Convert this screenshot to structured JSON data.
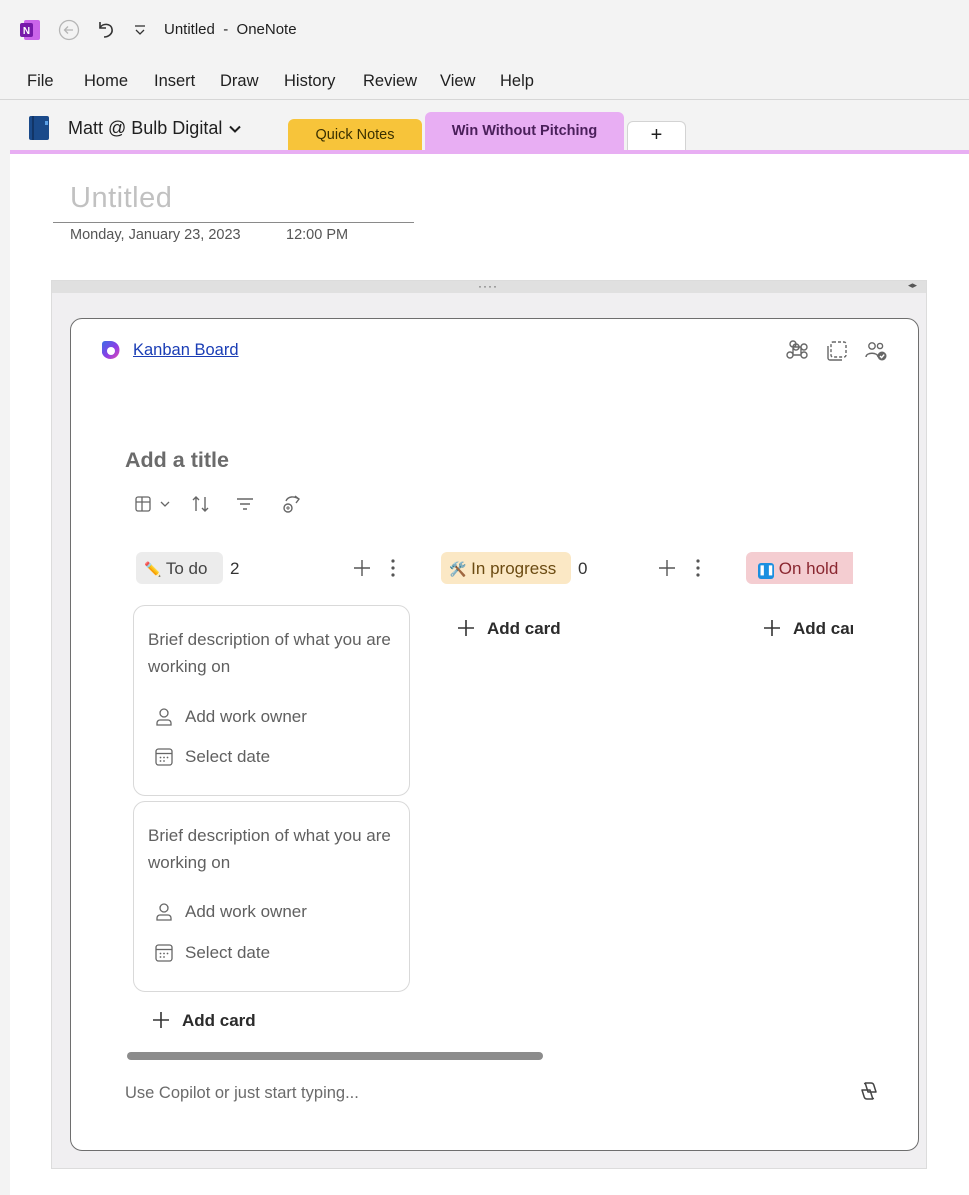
{
  "window": {
    "title": "Untitled  -  OneNote"
  },
  "menu": [
    "File",
    "Home",
    "Insert",
    "Draw",
    "History",
    "Review",
    "View",
    "Help"
  ],
  "notebook": {
    "name": "Matt @ Bulb Digital"
  },
  "sections": [
    {
      "label": "Quick Notes",
      "color": "#f7c43a"
    },
    {
      "label": "Win Without Pitching",
      "color": "#e8aef3",
      "active": true
    },
    {
      "label": "+"
    }
  ],
  "page": {
    "title": "Untitled",
    "date": "Monday, January 23, 2023",
    "time": "12:00 PM"
  },
  "loop": {
    "link": "Kanban Board",
    "board_title": "Add a title",
    "columns": [
      {
        "emoji": "✏️",
        "label": "To do",
        "count": "2",
        "color": "#ececec"
      },
      {
        "emoji": "🛠️",
        "label": "In progress",
        "count": "0",
        "color": "#fbe8c5"
      },
      {
        "emoji": "⏸",
        "label": "On hold",
        "color": "#f4cdd1"
      }
    ],
    "add_card": "Add card",
    "add_card_clipped": "Add car",
    "cards": [
      {
        "description": "Brief description of what you are working on",
        "owner": "Add work owner",
        "date": "Select date"
      },
      {
        "description": "Brief description of what you are working on",
        "owner": "Add work owner",
        "date": "Select date"
      }
    ],
    "copilot_placeholder": "Use Copilot or just start typing..."
  },
  "icons": {
    "app": "onenote-logo-icon",
    "back": "back-arrow-icon",
    "undo": "undo-icon",
    "customize": "quick-access-dropdown-icon",
    "notebook": "notebook-icon",
    "loop": "loop-icon",
    "apps": "command-icon",
    "copy": "copy-component-icon",
    "share": "shared-people-icon",
    "view": "table-view-icon",
    "sort": "sort-icon",
    "filter": "filter-icon",
    "share_out": "share-out-icon",
    "copilot": "copilot-icon"
  }
}
